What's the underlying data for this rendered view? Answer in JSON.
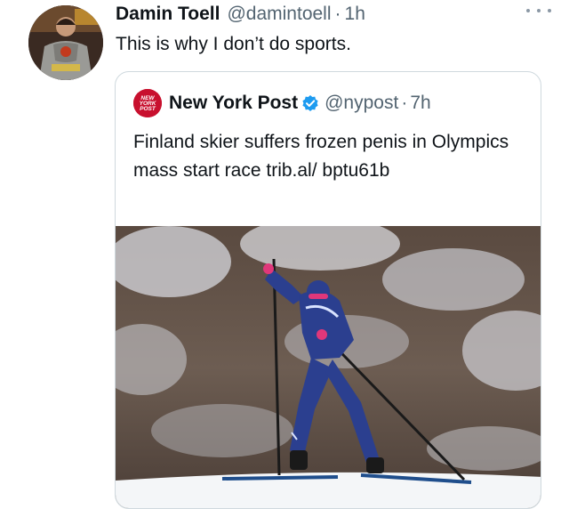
{
  "tweet": {
    "author_name": "Damin Toell",
    "author_handle": "@damintoell",
    "separator": "·",
    "time": "1h",
    "text": "This is why I don’t do sports."
  },
  "quoted_tweet": {
    "author_name": "New York Post",
    "author_handle": "@nypost",
    "separator": "·",
    "time": "7h",
    "text": "Finland skier suffers frozen penis in Olympics mass start race trib.al/ bptu61b",
    "logo_text": [
      "NEW",
      "YORK",
      "POST"
    ]
  },
  "icons": {
    "more": "more-horizontal-icon",
    "verified": "verified-badge-icon"
  },
  "colors": {
    "text_primary": "#0f1419",
    "text_secondary": "#536471",
    "card_border": "#cfd9de",
    "verified": "#1d9bf0",
    "nyp_red": "#c8102e"
  }
}
